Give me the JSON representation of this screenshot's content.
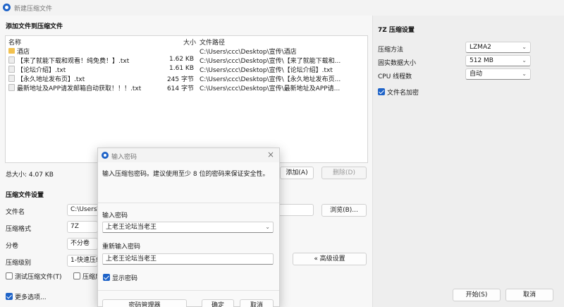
{
  "window": {
    "title": "新建压缩文件"
  },
  "files_section": {
    "title": "添加文件到压缩文件",
    "columns": {
      "name": "名称",
      "size": "大小",
      "path": "文件路径"
    },
    "rows": [
      {
        "icon": "folder-icon",
        "name": "酒店",
        "size": "",
        "path": "C:\\Users\\ccc\\Desktop\\宣传\\酒店"
      },
      {
        "icon": "text-file-icon",
        "name": "【来了就能下载和观看！纯免费！】.txt",
        "size": "1.62 KB",
        "path": "C:\\Users\\ccc\\Desktop\\宣传\\【来了就能下载和..."
      },
      {
        "icon": "text-file-icon",
        "name": "【论坛介绍】.txt",
        "size": "1.61 KB",
        "path": "C:\\Users\\ccc\\Desktop\\宣传\\【论坛介绍】.txt"
      },
      {
        "icon": "text-file-icon",
        "name": "【永久地址发布页】.txt",
        "size": "245 字节",
        "path": "C:\\Users\\ccc\\Desktop\\宣传\\【永久地址发布页..."
      },
      {
        "icon": "text-file-icon",
        "name": "最新地址及APP请发邮箱自动获取！！！.txt",
        "size": "614 字节",
        "path": "C:\\Users\\ccc\\Desktop\\宣传\\最新地址及APP请..."
      }
    ],
    "total_size": "总大小: 4.07 KB",
    "add_button": "添加(A)",
    "delete_button": "删除(D)"
  },
  "archive_settings": {
    "title": "压缩文件设置",
    "filename_label": "文件名",
    "filename_value": "C:\\Users\\",
    "browse_button": "浏览(B)...",
    "format_label": "压缩格式",
    "format_value": "7Z",
    "split_label": "分卷",
    "split_value": "不分卷",
    "level_label": "压缩级别",
    "level_value": "1-快速压缩",
    "advanced_button": "« 高级设置",
    "test_checkbox": "测试压缩文件(T)",
    "other_checkbox": "压缩后"
  },
  "bottom": {
    "more_options": "更多选项...",
    "start_button": "开始(S)",
    "cancel_button": "取消"
  },
  "sevenz": {
    "title": "7Z 压缩设置",
    "method_label": "压缩方法",
    "method_value": "LZMA2",
    "block_label": "固实数据大小",
    "block_value": "512 MB",
    "threads_label": "CPU 线程数",
    "threads_value": "自动",
    "encrypt_label": "文件名加密"
  },
  "dialog": {
    "title": "输入密码",
    "description": "输入压缩包密码。建议使用至少 8 位的密码来保证安全性。",
    "password_label": "输入密码",
    "password_value": "上老王论坛当老王",
    "repeat_label": "重新输入密码",
    "repeat_value": "上老王论坛当老王",
    "show_password": "显示密码",
    "manager_button": "密码管理器",
    "ok_button": "确定",
    "cancel_button": "取消"
  },
  "colors": {
    "accent": "#1e63c8",
    "folder": "#f2c14e"
  }
}
